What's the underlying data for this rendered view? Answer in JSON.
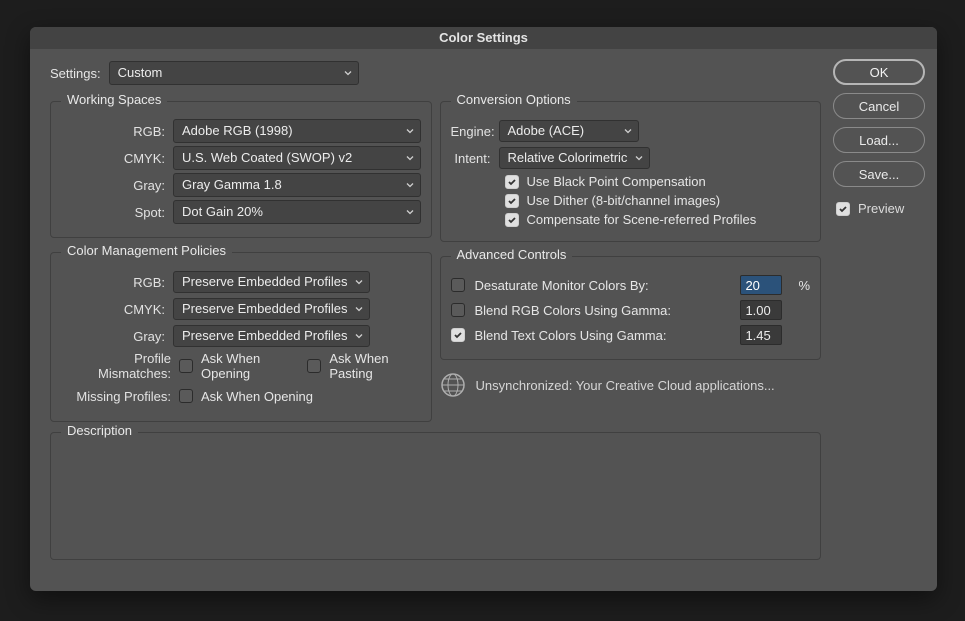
{
  "dialog_title": "Color Settings",
  "settings_label": "Settings:",
  "settings_value": "Custom",
  "working_spaces": {
    "legend": "Working Spaces",
    "rgb_label": "RGB:",
    "rgb_value": "Adobe RGB (1998)",
    "cmyk_label": "CMYK:",
    "cmyk_value": "U.S. Web Coated (SWOP) v2",
    "gray_label": "Gray:",
    "gray_value": "Gray Gamma 1.8",
    "spot_label": "Spot:",
    "spot_value": "Dot Gain 20%"
  },
  "policies": {
    "legend": "Color Management Policies",
    "rgb_label": "RGB:",
    "rgb_value": "Preserve Embedded Profiles",
    "cmyk_label": "CMYK:",
    "cmyk_value": "Preserve Embedded Profiles",
    "gray_label": "Gray:",
    "gray_value": "Preserve Embedded Profiles",
    "mismatch_label": "Profile Mismatches:",
    "mismatch_open": "Ask When Opening",
    "mismatch_paste": "Ask When Pasting",
    "missing_label": "Missing Profiles:",
    "missing_open": "Ask When Opening"
  },
  "conversion": {
    "legend": "Conversion Options",
    "engine_label": "Engine:",
    "engine_value": "Adobe (ACE)",
    "intent_label": "Intent:",
    "intent_value": "Relative Colorimetric",
    "bpc": "Use Black Point Compensation",
    "dither": "Use Dither (8-bit/channel images)",
    "scene": "Compensate for Scene-referred Profiles"
  },
  "advanced": {
    "legend": "Advanced Controls",
    "desat_label": "Desaturate Monitor Colors By:",
    "desat_value": "20",
    "desat_pct": "%",
    "blend_rgb_label": "Blend RGB Colors Using Gamma:",
    "blend_rgb_value": "1.00",
    "blend_text_label": "Blend Text Colors Using Gamma:",
    "blend_text_value": "1.45"
  },
  "unsync_text": "Unsynchronized: Your Creative Cloud applications...",
  "description_legend": "Description",
  "buttons": {
    "ok": "OK",
    "cancel": "Cancel",
    "load": "Load...",
    "save": "Save...",
    "preview": "Preview"
  }
}
